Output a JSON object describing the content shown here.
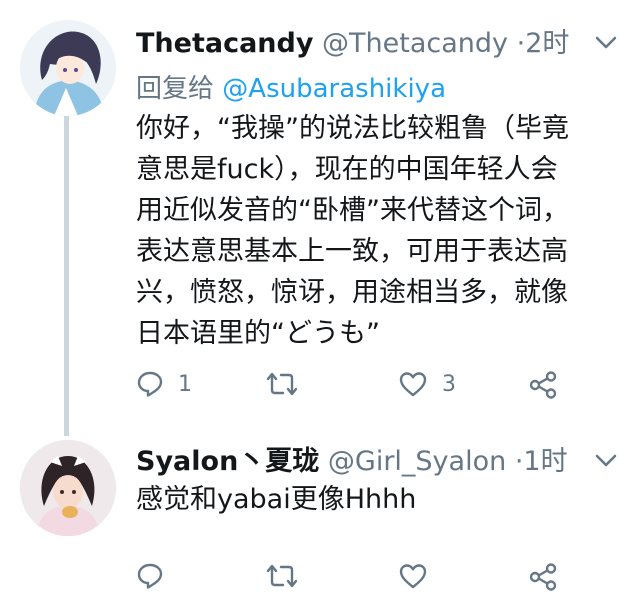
{
  "tweets": [
    {
      "display_name": "Thetacandy",
      "handle": "@Thetacandy",
      "separator": "·",
      "time": "2时",
      "reply_prefix": "回复给",
      "reply_mention": "@Asubarashikiya",
      "text_lines": [
        "你好，“我操”的说法比较粗鲁（毕竟",
        "意思是fuck），现在的中国年轻人会",
        "用近似发音的“卧槽”来代替这个词，",
        "表达意思基本上一致，可用于表达高",
        "兴，愤怒，惊讶，用途相当多，就像",
        "日本语里的“どうも”"
      ],
      "reply_count": "1",
      "retweet_count": "",
      "like_count": "3"
    },
    {
      "display_name": "Syalon丶夏珑",
      "handle": "@Girl_Syalon",
      "separator": "·",
      "time": "1时",
      "text_lines": [
        "感觉和yabai更像Hhhh"
      ],
      "reply_count": "",
      "retweet_count": "",
      "like_count": ""
    }
  ],
  "icons": [
    "reply-icon",
    "retweet-icon",
    "like-icon",
    "share-icon",
    "chevron-down-icon"
  ],
  "colors": {
    "text": "#14171a",
    "secondary": "#657786",
    "link": "#1da1f2",
    "thread_line": "#ccd6dd"
  }
}
